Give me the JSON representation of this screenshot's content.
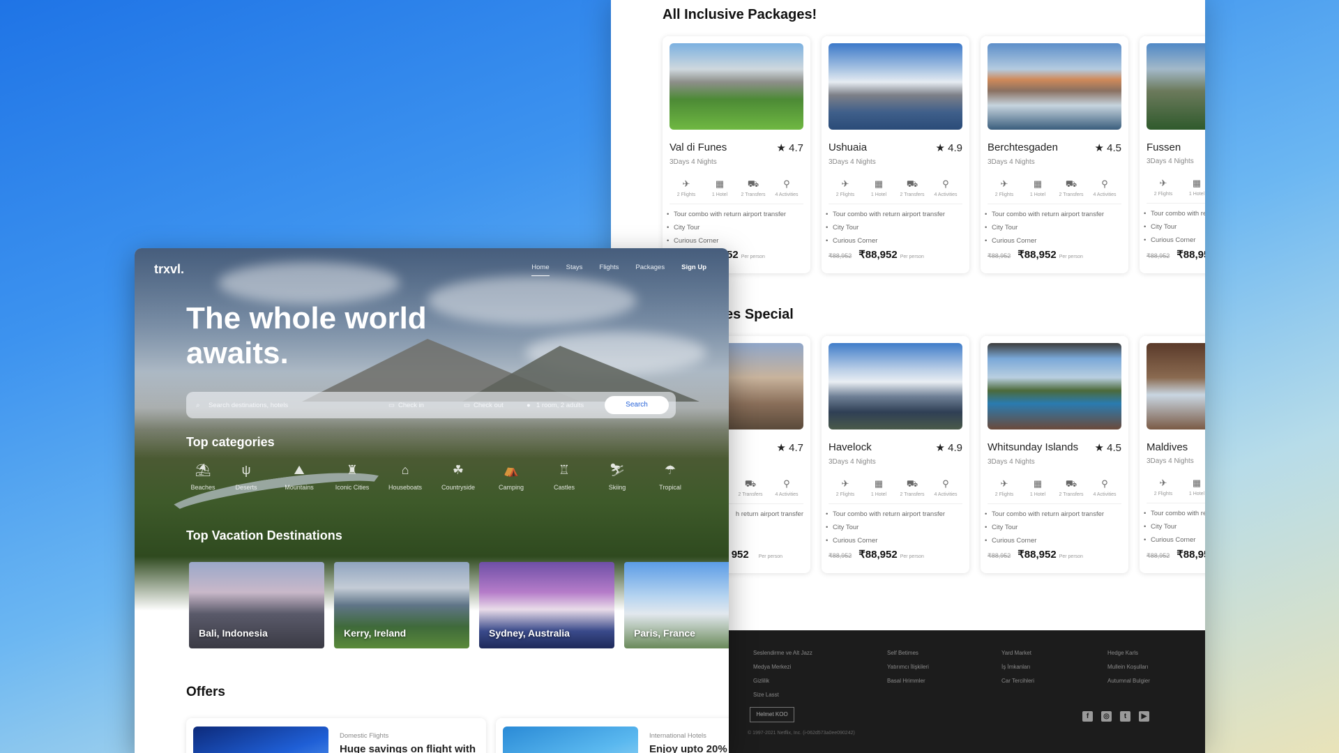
{
  "packages_page": {
    "section1_title": "All Inclusive Packages!",
    "section2_title": "on Freebies Special",
    "amenities": [
      "2 Flights",
      "1 Hotel",
      "2 Transfers",
      "4 Activities"
    ],
    "bullets": [
      "Tour combo with return airport transfer",
      "City Tour",
      "Curious Corner"
    ],
    "old_price": "₹88,952",
    "price": "₹88,952",
    "per_person": "Per person",
    "nights": "3Days 4 Nights",
    "row1": [
      {
        "name": "Val di Funes",
        "rating": "★ 4.7"
      },
      {
        "name": "Ushuaia",
        "rating": "★ 4.9"
      },
      {
        "name": "Berchtesgaden",
        "rating": "★ 4.5"
      },
      {
        "name": "Fussen",
        "rating": ""
      }
    ],
    "row2": [
      {
        "name": "",
        "rating": "★ 4.7"
      },
      {
        "name": "Havelock",
        "rating": "★ 4.9"
      },
      {
        "name": "Whitsunday Islands",
        "rating": "★ 4.5"
      },
      {
        "name": "Maldives",
        "rating": ""
      }
    ],
    "row2_first_amenities": [
      "2 Transfers",
      "4 Activities"
    ],
    "row2_first_bullet": "h return airport transfer",
    "row2_first_price": "952",
    "footer": {
      "col1": [
        "Seslendirme ve Alt Jazz",
        "Medya Merkezi",
        "Gizlilik",
        "Size Lasst"
      ],
      "col2": [
        "Self Betimes",
        "Yatırımcı İlişkileri",
        "Basal Hrimmler"
      ],
      "col3": [
        "Yard Market",
        "İş İmkanları",
        "Car Tercihleri"
      ],
      "col4": [
        "Hedge Karls",
        "Mullein Koşulları",
        "Autumnal Bulgier"
      ],
      "button": "Helmet KOO",
      "copyright": "© 1997-2021 Netflix, Inc. (i-062d573a0ee090242)"
    }
  },
  "home_page": {
    "logo": "trxvl.",
    "nav": [
      "Home",
      "Stays",
      "Flights",
      "Packages"
    ],
    "signup": "Sign Up",
    "headline": "The whole world awaits.",
    "search": {
      "placeholder": "Search destinations, hotels",
      "check_in": "Check in",
      "check_out": "Check out",
      "guests": "1 room, 2 adults",
      "button": "Search"
    },
    "categories_title": "Top categories",
    "categories": [
      "Beaches",
      "Deserts",
      "Mountains",
      "Iconic Cities",
      "Houseboats",
      "Countryside",
      "Camping",
      "Castles",
      "Skiing",
      "Tropical"
    ],
    "destinations_title": "Top Vacation Destinations",
    "destinations": [
      "Bali, Indonesia",
      "Kerry, Ireland",
      "Sydney, Australia",
      "Paris, France"
    ],
    "offers_title": "Offers",
    "offers": [
      {
        "category": "Domestic Flights",
        "headline": "Huge savings on flight with"
      },
      {
        "category": "International Hotels",
        "headline": "Enjoy upto 20%"
      }
    ]
  }
}
